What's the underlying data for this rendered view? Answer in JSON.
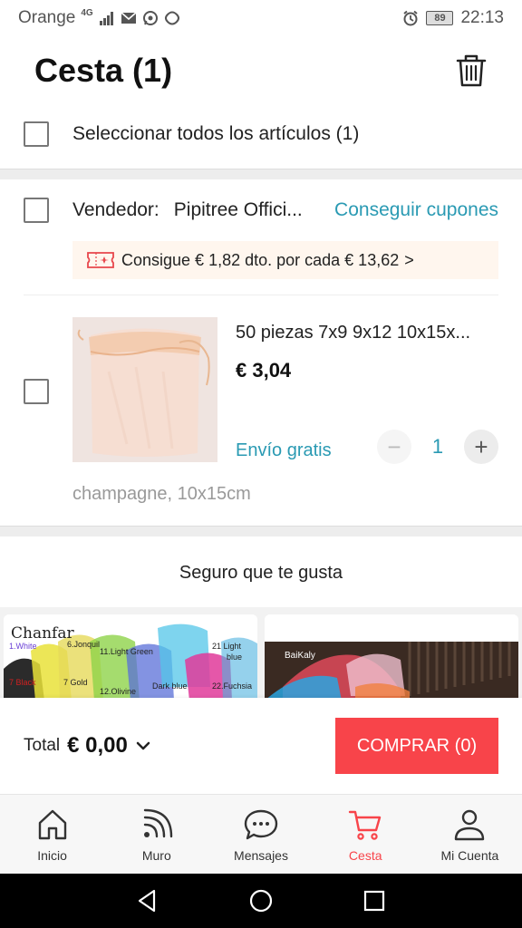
{
  "status_bar": {
    "carrier": "Orange",
    "network": "4G",
    "battery": "89",
    "time": "22:13"
  },
  "header": {
    "title": "Cesta (1)"
  },
  "select_all": {
    "label": "Seleccionar todos los artículos (1)"
  },
  "seller": {
    "prefix": "Vendedor:",
    "name": "Pipitree Offici...",
    "coupon_link": "Conseguir cupones"
  },
  "promo": {
    "text": "Consigue € 1,82 dto. por cada € 13,62",
    "arrow": ">"
  },
  "product": {
    "title": "50 piezas 7x9 9x12 10x15x...",
    "price": "€ 3,04",
    "shipping": "Envío gratis",
    "quantity": "1",
    "minus": "−",
    "plus": "+",
    "variant": "champagne, 10x15cm"
  },
  "recommendations": {
    "title": "Seguro que te gusta",
    "card1": {
      "brand": "Chanfar",
      "labels": [
        "1.White",
        "6.Jonquil",
        "11.Light Green",
        "21 Light",
        "blue",
        "7 Black",
        "7 Gold",
        "12.Olivine",
        "Dark blue",
        "22.Fuchsia"
      ]
    },
    "card2": {
      "brand": "BaiKaly"
    }
  },
  "checkout": {
    "total_label": "Total",
    "total_value": "€ 0,00",
    "buy_label": "COMPRAR (0)"
  },
  "bottom_nav": {
    "items": [
      {
        "label": "Inicio",
        "icon": "home-icon"
      },
      {
        "label": "Muro",
        "icon": "feed-icon"
      },
      {
        "label": "Mensajes",
        "icon": "message-icon"
      },
      {
        "label": "Cesta",
        "icon": "cart-icon"
      },
      {
        "label": "Mi Cuenta",
        "icon": "user-icon"
      }
    ],
    "active": "Cesta"
  },
  "colors": {
    "accent_teal": "#2a9ab3",
    "buy_red": "#f8444a",
    "promo_bg": "#fff6ee"
  }
}
